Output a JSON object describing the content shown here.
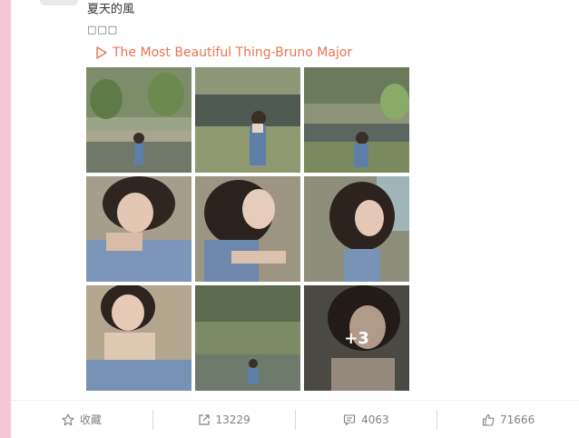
{
  "post": {
    "text": "夏天的風",
    "emoji_line": "□□□",
    "music_link": "The Most Beautiful Thing-Bruno Major"
  },
  "photos": {
    "more_label": "+3"
  },
  "actions": {
    "favorite_label": "收藏",
    "repost_count": "13229",
    "comment_count": "4063",
    "like_count": "71666"
  },
  "colors": {
    "link": "#eb7350",
    "left_strip": "#f5c6d6",
    "action_text": "#808080"
  }
}
